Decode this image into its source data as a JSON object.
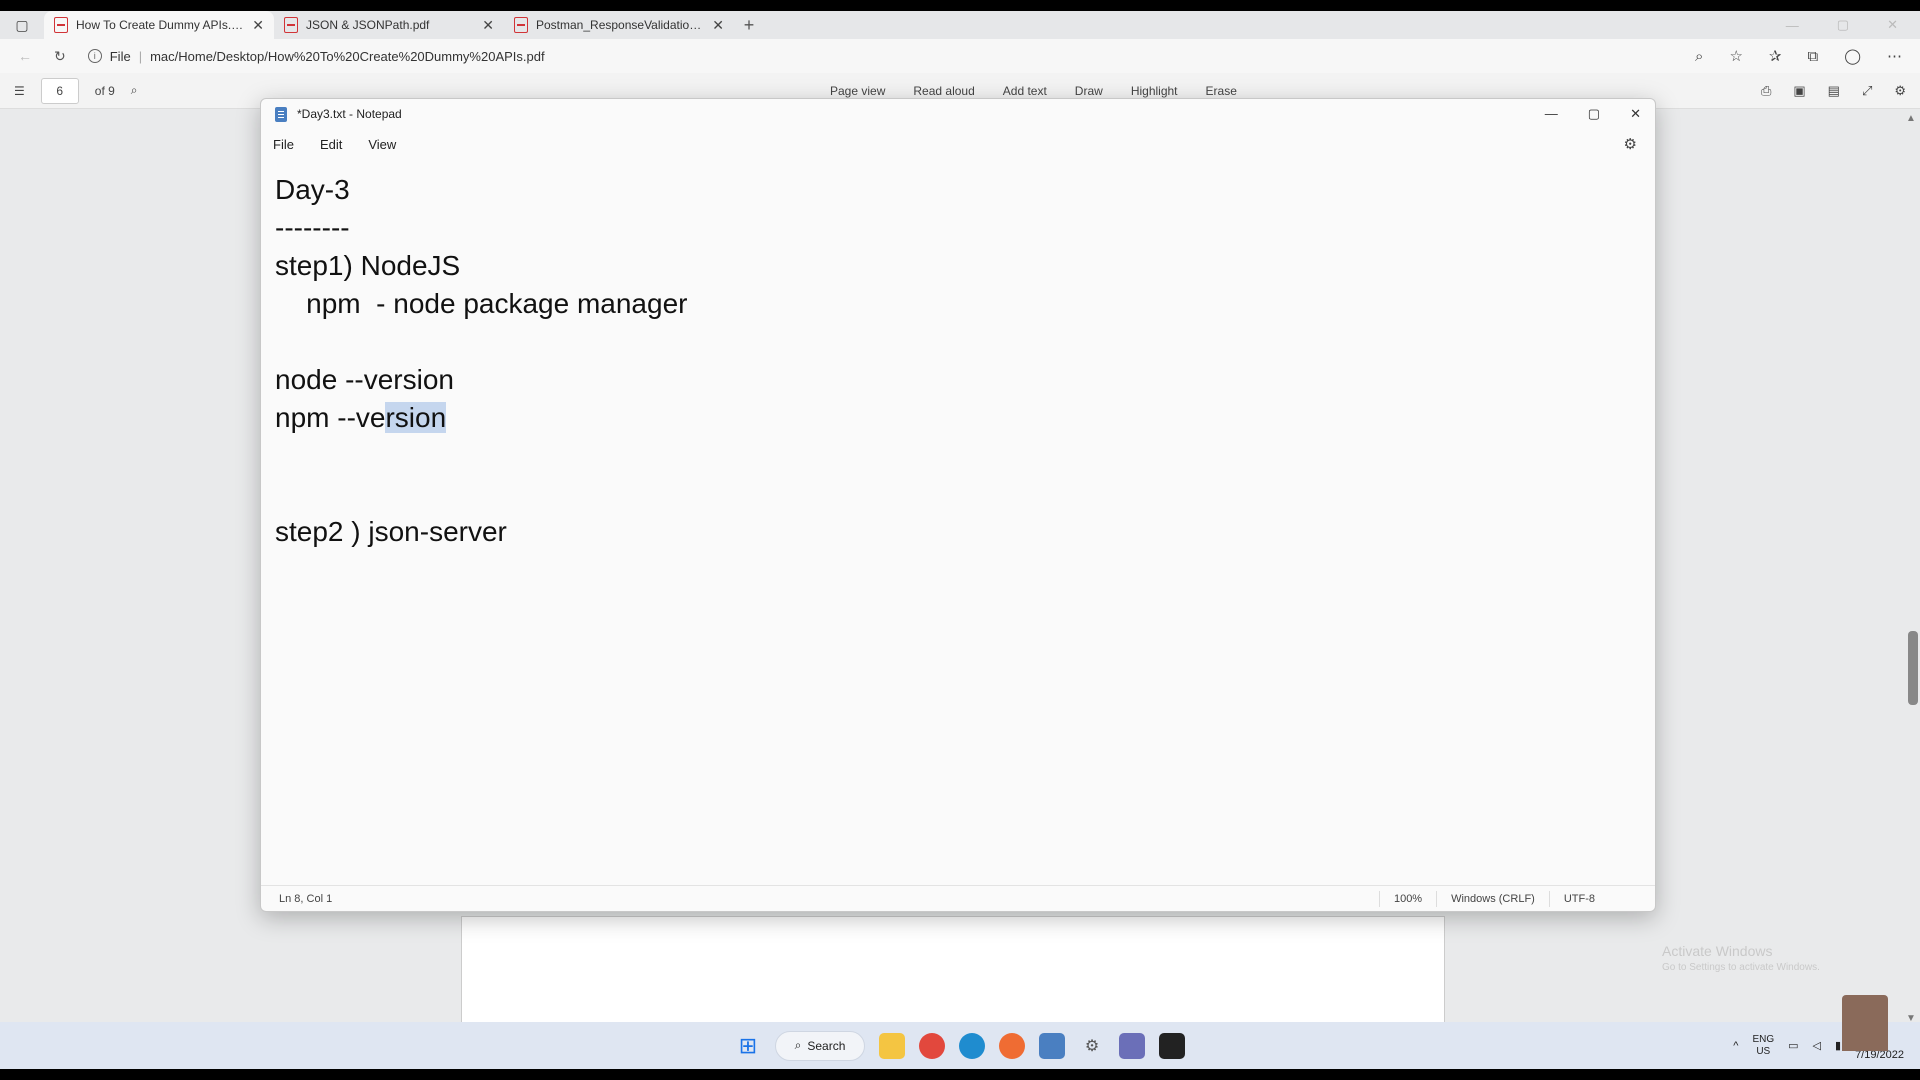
{
  "browser": {
    "tabs": [
      {
        "label": "How To Create Dummy APIs.pdf",
        "active": true
      },
      {
        "label": "JSON & JSONPath.pdf",
        "active": false
      },
      {
        "label": "Postman_ResponseValidations.p",
        "active": false
      }
    ],
    "address": {
      "file_label": "File",
      "url": "mac/Home/Desktop/How%20To%20Create%20Dummy%20APIs.pdf"
    }
  },
  "pdf_toolbar": {
    "page_current": "6",
    "page_total": "of 9",
    "tools": [
      "Page view",
      "Read aloud",
      "Add text",
      "Draw",
      "Highlight",
      "Erase"
    ]
  },
  "notepad": {
    "title": "*Day3.txt - Notepad",
    "menu": [
      "File",
      "Edit",
      "View"
    ],
    "lines": [
      "Day-3",
      "--------",
      "step1) NodeJS",
      "    npm  - node package manager",
      "",
      "node --version",
      "npm --ve",
      "",
      "",
      "step2 ) json-server"
    ],
    "selected_text": "rsion",
    "status": {
      "position": "Ln 8, Col 1",
      "zoom": "100%",
      "line_ending": "Windows (CRLF)",
      "encoding": "UTF-8"
    }
  },
  "watermark": {
    "title": "Activate Windows",
    "subtitle": "Go to Settings to activate Windows."
  },
  "taskbar": {
    "search_label": "Search",
    "lang_top": "ENG",
    "lang_bottom": "US",
    "date": "7/19/2022"
  },
  "icons": [
    "windows-start-icon",
    "search-icon",
    "file-explorer-icon",
    "chrome-icon",
    "edge-icon",
    "postman-icon",
    "notepad-icon",
    "settings-icon",
    "app-icon",
    "terminal-icon"
  ]
}
